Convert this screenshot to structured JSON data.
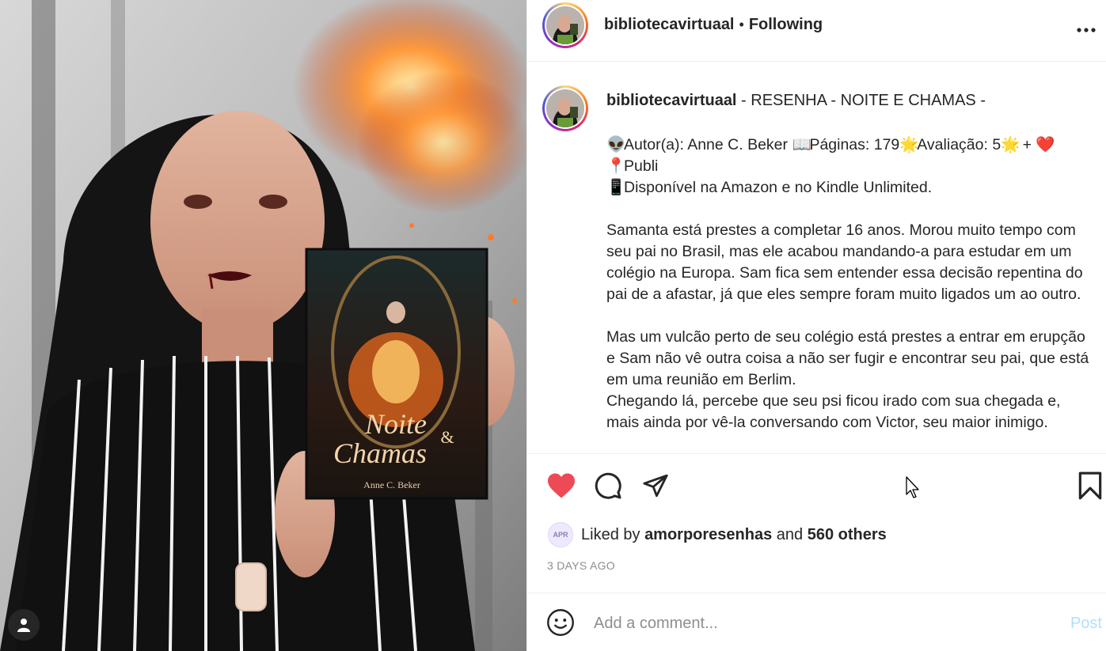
{
  "post": {
    "username": "bibliotecavirtuaal",
    "follow_status": "Following",
    "caption": {
      "username": "bibliotecavirtuaal",
      "title": " - RESENHA - NOITE E CHAMAS -",
      "line1": "Autor(a): Anne C. Beker ",
      "line1b": "Páginas: 179",
      "line1c": "Avaliação: 5",
      "line1d": " + ",
      "line2": "Publi",
      "line3": "Disponível na Amazon e no Kindle Unlimited.",
      "para1": "Samanta está prestes a completar 16 anos. Morou muito tempo com seu pai no Brasil, mas ele acabou mandando-a para estudar em um colégio na Europa. Sam fica sem entender essa decisão repentina do pai de a afastar, já que eles sempre foram muito ligados um ao outro.",
      "para2": "Mas um vulcão perto de seu colégio está prestes a entrar em erupção e Sam não vê outra coisa a não ser fugir e encontrar seu pai, que está em uma reunião em Berlim.",
      "para3": "Chegando lá, percebe que seu psi ficou irado com sua chegada e, mais ainda por vê-la conversando com Victor, seu maior inimigo."
    },
    "likes": {
      "prefix": "Liked by ",
      "liker": "amorporesenhas",
      "middle": " and ",
      "others": "560 others",
      "liker_avatar_text": "APR"
    },
    "time_ago": "3 DAYS AGO",
    "comment_placeholder": "Add a comment...",
    "post_button": "Post",
    "book": {
      "title_line1": "Noite",
      "title_amp": "&",
      "title_line2": "Chamas",
      "author": "Anne C. Beker"
    }
  },
  "icons": {
    "more": "more-options-icon",
    "like": "heart-filled-icon",
    "comment": "comment-icon",
    "share": "send-icon",
    "save": "bookmark-icon",
    "emoji": "emoji-smile-icon",
    "tag": "user-tag-icon"
  },
  "colors": {
    "like_red": "#ed4956",
    "link_blue_disabled": "#b2dffc",
    "secondary_text": "#8e8e8e"
  }
}
